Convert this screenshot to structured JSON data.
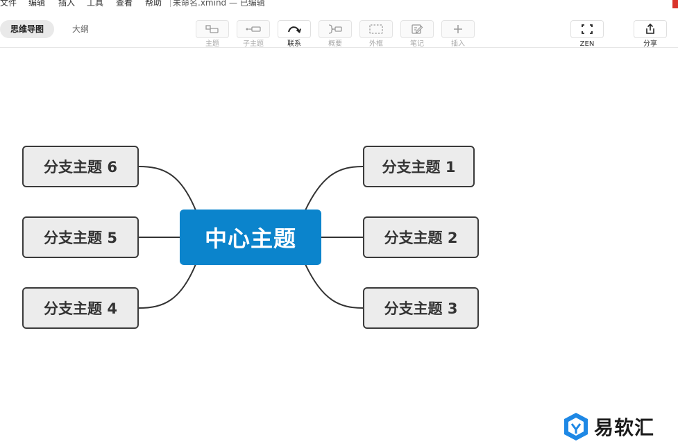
{
  "menu": {
    "items": [
      "文件",
      "编辑",
      "插入",
      "工具",
      "查看",
      "帮助"
    ],
    "document_title": "未命名.xmind — 已编辑"
  },
  "view_tabs": {
    "mindmap": "思维导图",
    "outline": "大纲"
  },
  "toolbar": {
    "topic": "主题",
    "subtopic": "子主题",
    "relationship": "联系",
    "summary": "概要",
    "boundary": "外框",
    "note": "笔记",
    "insert": "插入",
    "zen": "ZEN",
    "share": "分享"
  },
  "mindmap": {
    "central_topic": "中心主题",
    "branches": [
      "分支主题 1",
      "分支主题 2",
      "分支主题 3",
      "分支主题 4",
      "分支主题 5",
      "分支主题 6"
    ]
  },
  "colors": {
    "central_topic_fill": "#0b84cc",
    "branch_fill": "#ececec",
    "branch_border": "#3a3a3a",
    "watermark_logo": "#1e88e5"
  },
  "watermark": {
    "text": "易软汇"
  }
}
